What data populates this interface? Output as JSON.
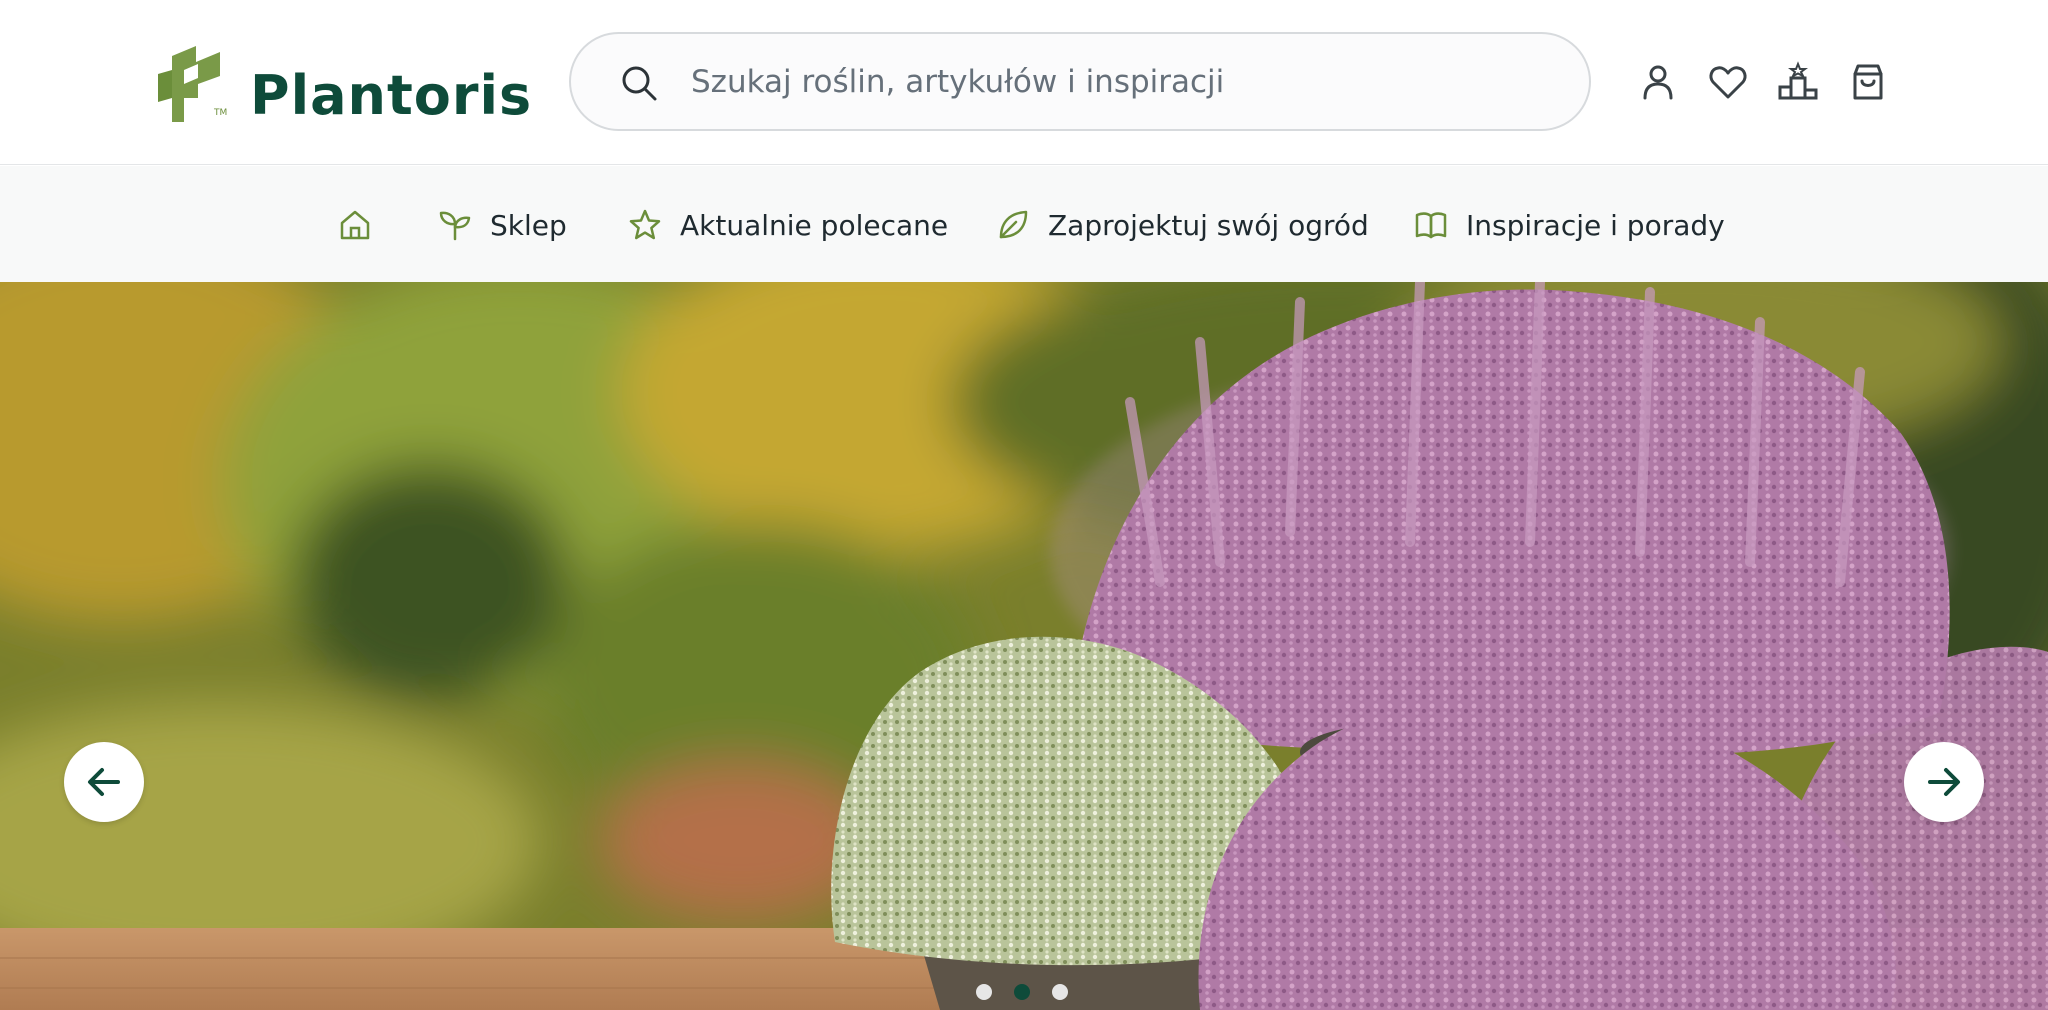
{
  "header": {
    "brand": "Plantoris",
    "trademark": "TM",
    "search": {
      "placeholder": "Szukaj roślin, artykułów i inspiracji",
      "value": ""
    },
    "icons": [
      "user-icon",
      "heart-icon",
      "podium-icon",
      "shopping-bag-icon"
    ]
  },
  "nav": {
    "items": [
      {
        "icon": "home-icon",
        "label": ""
      },
      {
        "icon": "sprout-icon",
        "label": "Sklep"
      },
      {
        "icon": "star-icon",
        "label": "Aktualnie polecane"
      },
      {
        "icon": "leaf-icon",
        "label": "Zaprojektuj swój ogród"
      },
      {
        "icon": "book-icon",
        "label": "Inspiracje i porady"
      }
    ]
  },
  "hero": {
    "slides_count": 3,
    "active_slide": 2
  },
  "colors": {
    "brand_dark": "#0e4b3a",
    "brand_light": "#6b8e3a",
    "text": "#1f2a30"
  }
}
